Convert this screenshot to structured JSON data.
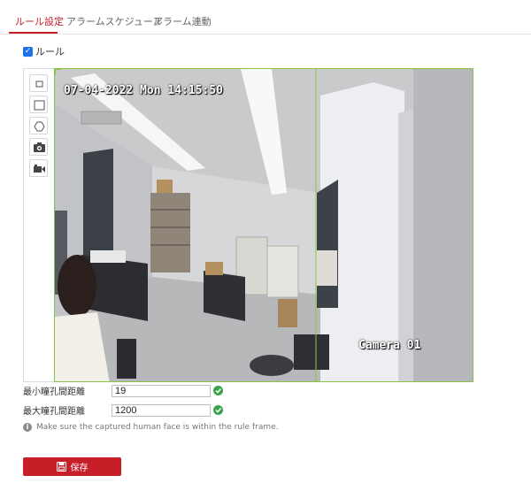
{
  "tabs": [
    {
      "label": "ルール設定",
      "active": true
    },
    {
      "label": "アラームスケジュール",
      "active": false
    },
    {
      "label": "アラーム連動",
      "active": false
    }
  ],
  "rule": {
    "label": "ルール",
    "checked": true
  },
  "toolbar": {
    "icons": [
      "square-outline-icon",
      "rectangle-outline-icon",
      "hexagon-outline-icon",
      "camera-icon",
      "video-camera-icon"
    ]
  },
  "video": {
    "timestamp": "07-04-2022 Mon 14:15:50",
    "camera_name": "Camera 01"
  },
  "fields": {
    "min_pupil_distance": {
      "label": "最小瞳孔間距離",
      "value": "19"
    },
    "max_pupil_distance": {
      "label": "最大瞳孔間距離",
      "value": "1200"
    }
  },
  "hint": "Make sure the captured human face is within the rule frame.",
  "save_label": "保存",
  "colors": {
    "accent": "#c81e28",
    "frame": "#8bc34a",
    "ok": "#3aa34a"
  }
}
